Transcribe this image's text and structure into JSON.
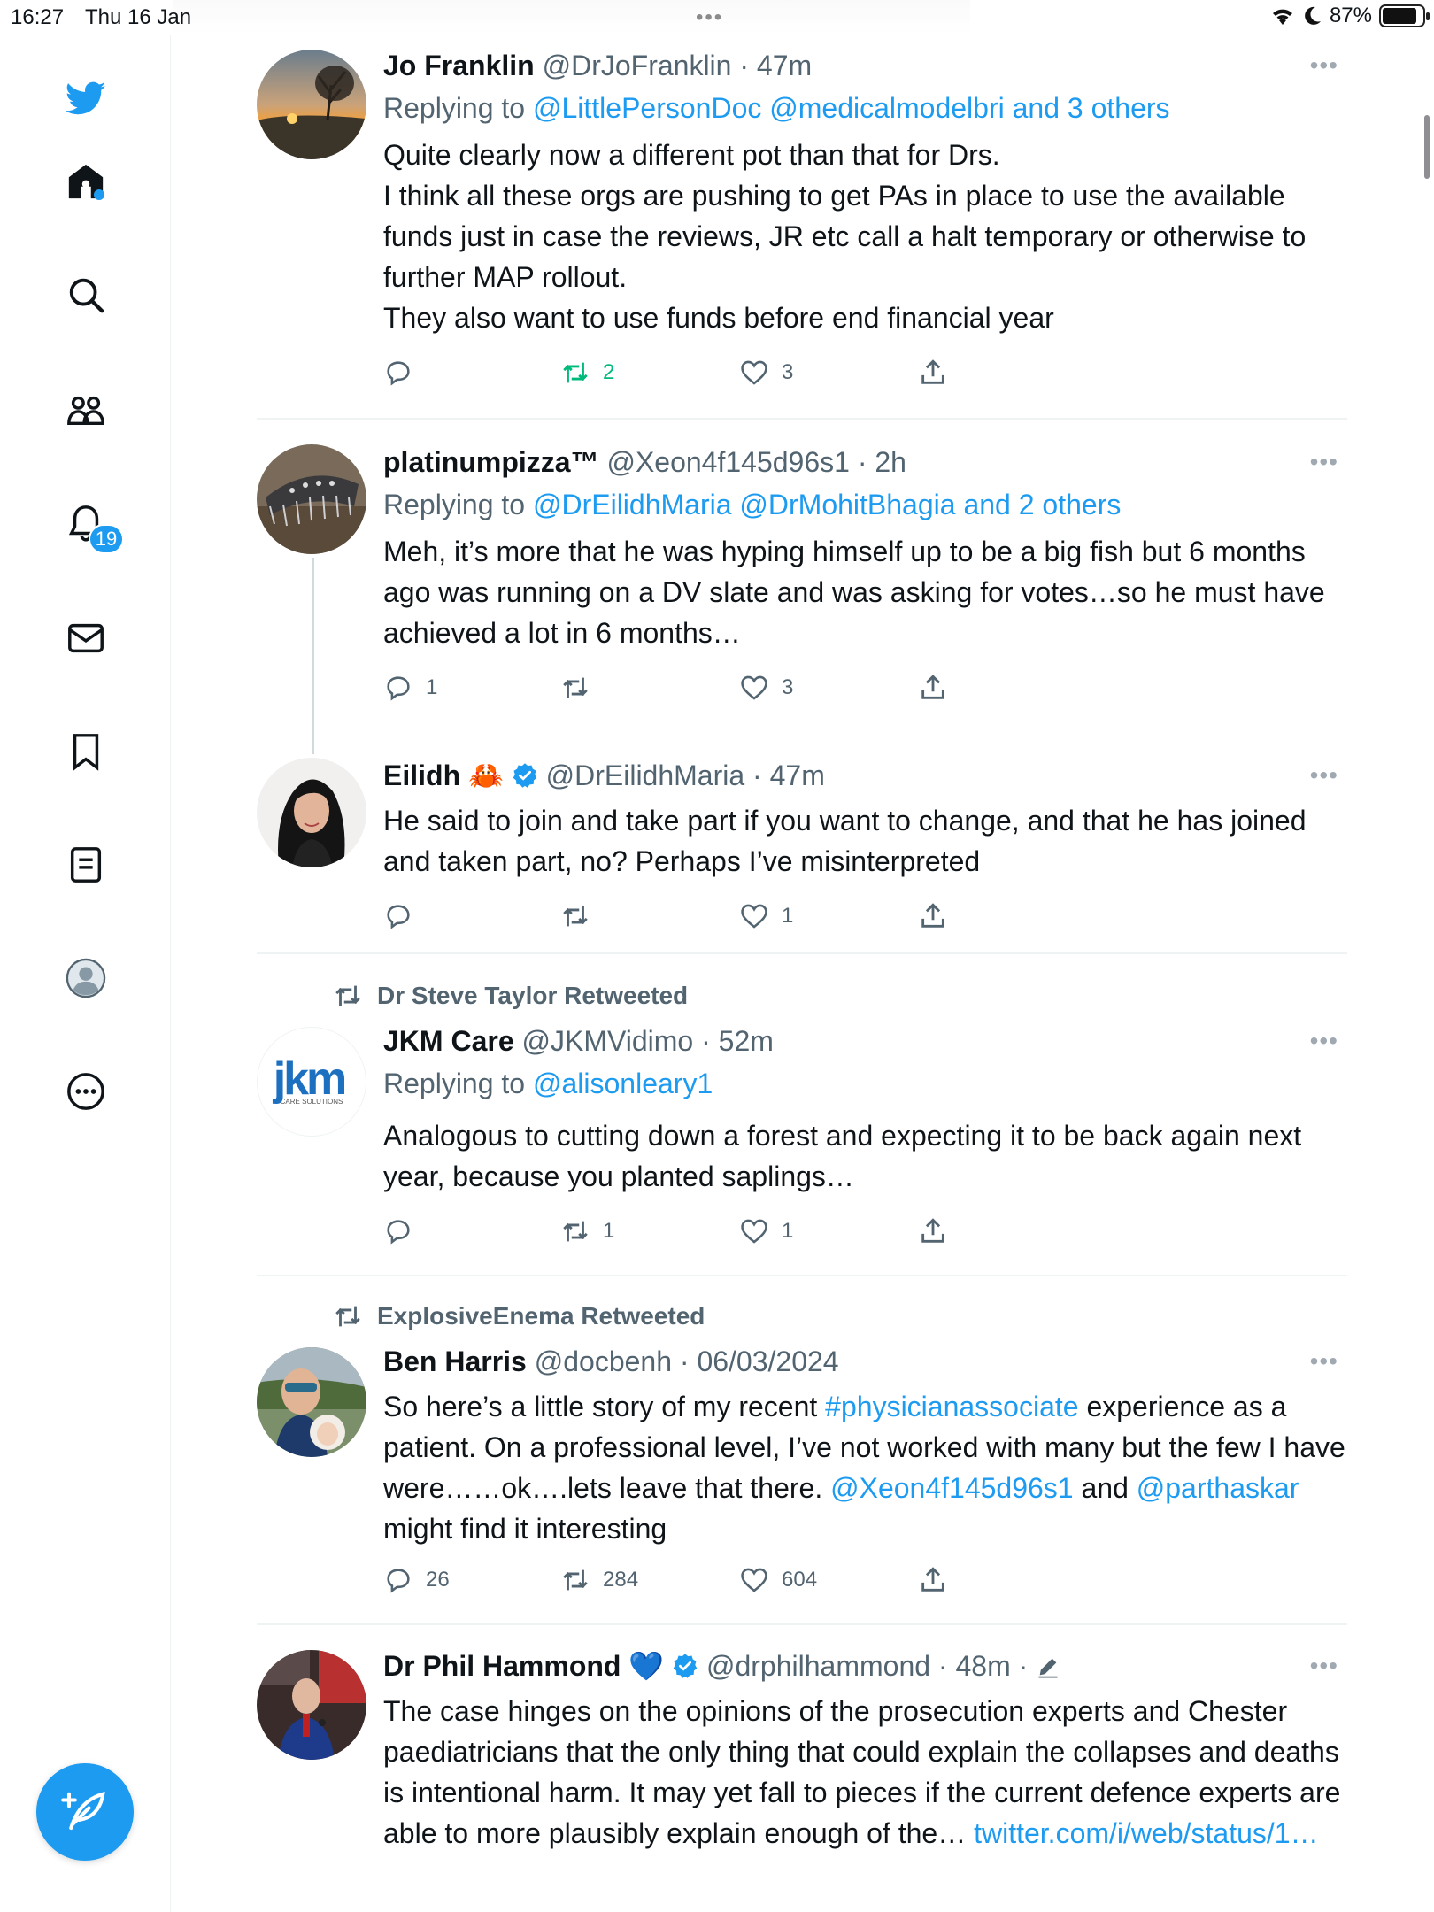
{
  "status_bar": {
    "time": "16:27",
    "date": "Thu 16 Jan",
    "battery": "87%",
    "battery_level": 0.87
  },
  "sidebar": {
    "items": [
      {
        "name": "twitter-logo-icon"
      },
      {
        "name": "home-icon"
      },
      {
        "name": "search-icon"
      },
      {
        "name": "communities-icon"
      },
      {
        "name": "notifications-icon",
        "badge": "19"
      },
      {
        "name": "messages-icon"
      },
      {
        "name": "bookmarks-icon"
      },
      {
        "name": "lists-icon"
      },
      {
        "name": "profile-icon"
      },
      {
        "name": "more-icon"
      }
    ],
    "compose": "compose-tweet-icon"
  },
  "colors": {
    "accent": "#1d9bf0",
    "retweet_active": "#00ba7c",
    "muted": "#536471"
  },
  "tweets": [
    {
      "name": "Jo Franklin",
      "handle": "@DrJoFranklin",
      "time": "· 47m",
      "replying_prefix": "Replying to ",
      "replying_to": "@LittlePersonDoc @medicalmodelbri and 3 others",
      "text": "Quite clearly now a different pot than that for Drs.\nI think all these orgs are pushing to get PAs in place to use the available funds just in case the reviews, JR etc call a halt temporary or otherwise to further MAP rollout.\nThey also want to use funds before end financial year",
      "replies": "",
      "retweets": "2",
      "likes": "3"
    },
    {
      "name": "platinumpizza™",
      "handle": "@Xeon4f145d96s1",
      "time": "· 2h",
      "replying_prefix": "Replying to ",
      "replying_to": "@DrEilidhMaria @DrMohitBhagia and 2 others",
      "text": "Meh, it’s more that he was hyping himself up to be a big fish but 6 months ago was running on a DV slate and was asking for votes…so he must have achieved a lot in 6 months…",
      "replies": "1",
      "retweets": "",
      "likes": "3"
    },
    {
      "name": "Eilidh",
      "emoji": "🦀",
      "handle": "@DrEilidhMaria",
      "time": "· 47m",
      "text": "He said to join and take part if you want to change, and that he has joined and taken part, no? Perhaps I’ve misinterpreted",
      "replies": "",
      "retweets": "",
      "likes": "1"
    },
    {
      "retweeted_by": "Dr Steve Taylor Retweeted",
      "name": "JKM Care",
      "handle": "@JKMVidimo",
      "time": "· 52m",
      "avatar_logo": "jkm",
      "avatar_logo_sub": "CARE SOLUTIONS",
      "replying_prefix": "Replying to ",
      "replying_to": "@alisonleary1",
      "text": "Analogous to cutting down a forest and expecting it to be back again next year, because you planted saplings…",
      "replies": "",
      "retweets": "1",
      "likes": "1"
    },
    {
      "retweeted_by": "ExplosiveEnema Retweeted",
      "name": "Ben Harris",
      "handle": "@docbenh",
      "time": "· 06/03/2024",
      "text_parts": [
        "So here’s a little story of my recent ",
        "#physicianassociate",
        " experience as a patient. On a professional level, I’ve not worked with many but the few I have were……ok….lets leave that there. ",
        "@Xeon4f145d96s1",
        " and ",
        "@parthaskar",
        " might find it interesting"
      ],
      "replies": "26",
      "retweets": "284",
      "likes": "604"
    },
    {
      "name": "Dr Phil Hammond",
      "emoji": "💙",
      "handle": "@drphilhammond",
      "time": "· 48m ·",
      "text": "The case hinges on the opinions of the prosecution experts and Chester paediatricians that the only thing that could explain the collapses and deaths is intentional harm. It may yet fall to pieces if the current defence experts are able to more plausibly explain enough of the… ",
      "link": "twitter.com/i/web/status/1…"
    }
  ]
}
